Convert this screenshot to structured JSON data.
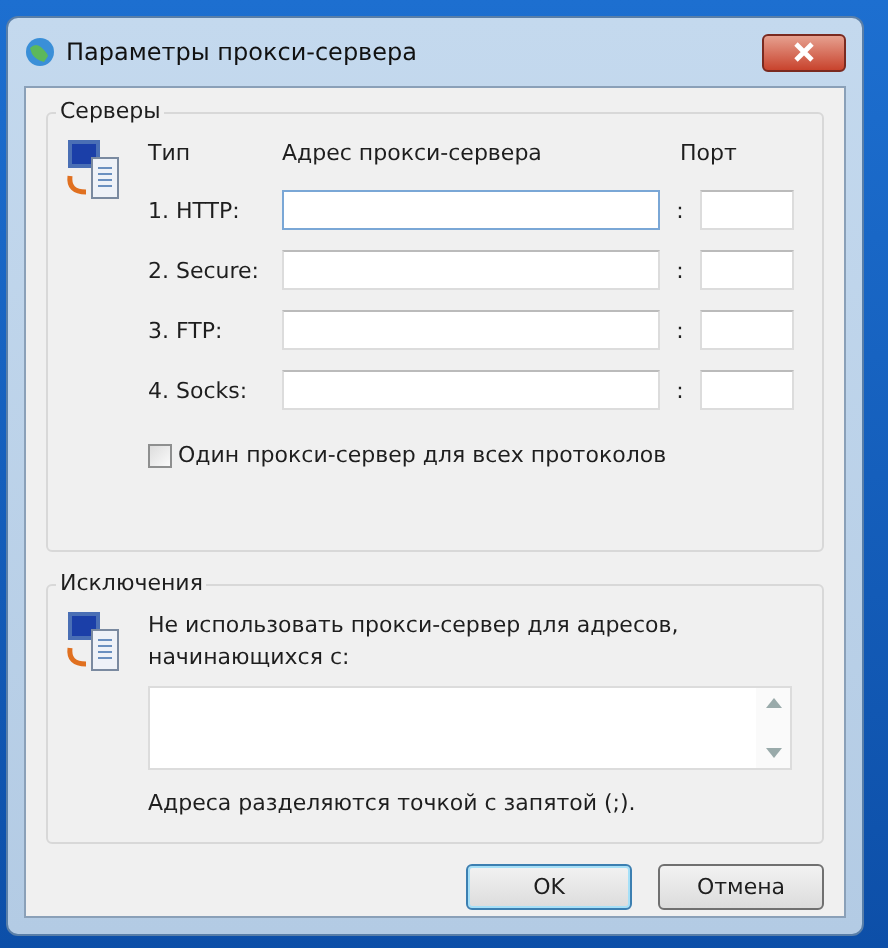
{
  "window": {
    "title": "Параметры прокси-сервера"
  },
  "servers": {
    "legend": "Серверы",
    "headers": {
      "type": "Тип",
      "address": "Адрес прокси-сервера",
      "port": "Порт"
    },
    "rows": [
      {
        "label": "1. HTTP:",
        "separator": ":",
        "focused": true
      },
      {
        "label": "2. Secure:",
        "separator": ":",
        "focused": false
      },
      {
        "label": "3. FTP:",
        "separator": ":",
        "focused": false
      },
      {
        "label": "4. Socks:",
        "separator": ":",
        "focused": false
      }
    ],
    "same_proxy": {
      "label": "Один прокси-сервер для всех протоколов",
      "checked": false
    }
  },
  "exceptions": {
    "legend": "Исключения",
    "description": "Не использовать прокси-сервер для адресов, начинающихся с:",
    "note": "Адреса разделяются точкой с запятой (;)."
  },
  "buttons": [
    {
      "label": "OK",
      "default": true
    },
    {
      "label": "Отмена",
      "default": false
    }
  ]
}
